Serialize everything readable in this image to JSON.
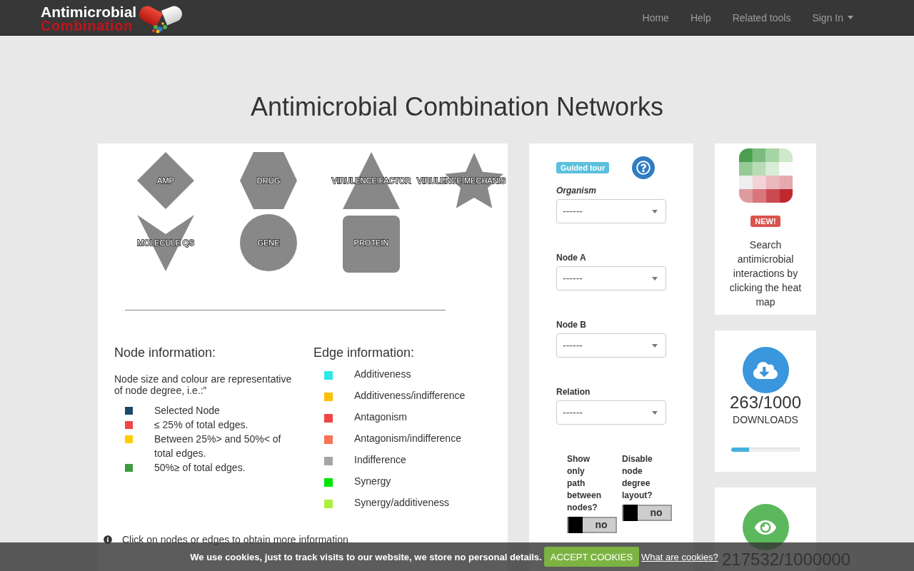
{
  "navbar": {
    "logo": {
      "title": "Antimicrobial",
      "subtitle": "Combination"
    },
    "links": [
      {
        "label": "Home",
        "dropdown": false
      },
      {
        "label": "Help",
        "dropdown": false
      },
      {
        "label": "Related tools",
        "dropdown": false
      },
      {
        "label": "Sign In",
        "dropdown": true
      }
    ]
  },
  "page_title": "Antimicrobial Combination Networks",
  "network_legend": {
    "nodes": [
      {
        "label": "AMP",
        "kind": "diamond"
      },
      {
        "label": "DRUG",
        "kind": "hexagon"
      },
      {
        "label": "VIRULENCE FACTOR",
        "kind": "triangle"
      },
      {
        "label": "VIRULENCE MECHANIS",
        "kind": "star"
      },
      {
        "label": "MOLECULE QS",
        "kind": "vee"
      },
      {
        "label": "GENE",
        "kind": "ellipse"
      },
      {
        "label": "PROTEIN",
        "kind": "round-rectangle"
      }
    ],
    "node_information": {
      "heading": "Node information:",
      "description": "Node size and colour are representative of node degree, i.e.:”",
      "items": [
        {
          "label": "Selected Node",
          "color": "#1d4a6b"
        },
        {
          "label": "≤ 25% of total edges.",
          "color": "#ef4646"
        },
        {
          "label": "Between 25%> and 50%< of total edges.",
          "color": "#ffcc00"
        },
        {
          "label": "50%≥ of total edges.",
          "color": "#3f9a3f"
        }
      ]
    },
    "edge_information": {
      "heading": "Edge information:",
      "items": [
        {
          "label": "Additiveness",
          "color": "#2ee8e8"
        },
        {
          "label": "Additiveness/indifference",
          "color": "#fbc00a"
        },
        {
          "label": "Antagonism",
          "color": "#f04545"
        },
        {
          "label": "Antagonism/indifference",
          "color": "#fa7354"
        },
        {
          "label": "Indifference",
          "color": "#a6a6a6"
        },
        {
          "label": "Synergy",
          "color": "#00e600"
        },
        {
          "label": "Synergy/additiveness",
          "color": "#adf03c"
        }
      ]
    },
    "hint": "Click on nodes or edges to obtain more information"
  },
  "filters": {
    "guided_tour": "Guided tour",
    "fields": [
      {
        "label": "Organism",
        "italic": true,
        "value": "------"
      },
      {
        "label": "Node A",
        "italic": false,
        "value": "------"
      },
      {
        "label": "Node B",
        "italic": false,
        "value": "------"
      },
      {
        "label": "Relation",
        "italic": false,
        "value": "------"
      }
    ],
    "toggles": [
      {
        "label": "Show only path between nodes?",
        "on": false,
        "state_text": "no"
      },
      {
        "label": "Disable node degree layout?",
        "on": false,
        "state_text": "no"
      }
    ]
  },
  "sidebar": {
    "heatmap_card": {
      "badge": "NEW!",
      "text": "Search antimicrobial interactions by clicking the heat map"
    },
    "downloads_card": {
      "count": "263/1000",
      "label": "DOWNLOADS",
      "level": 0.26
    },
    "visits_card": {
      "count": "217532/1000000"
    }
  },
  "cookie_banner": {
    "message": "We use cookies, just to track visits to our website, we store no personal details.",
    "button": "ACCEPT COOKIES",
    "link": "What are cookies?"
  }
}
